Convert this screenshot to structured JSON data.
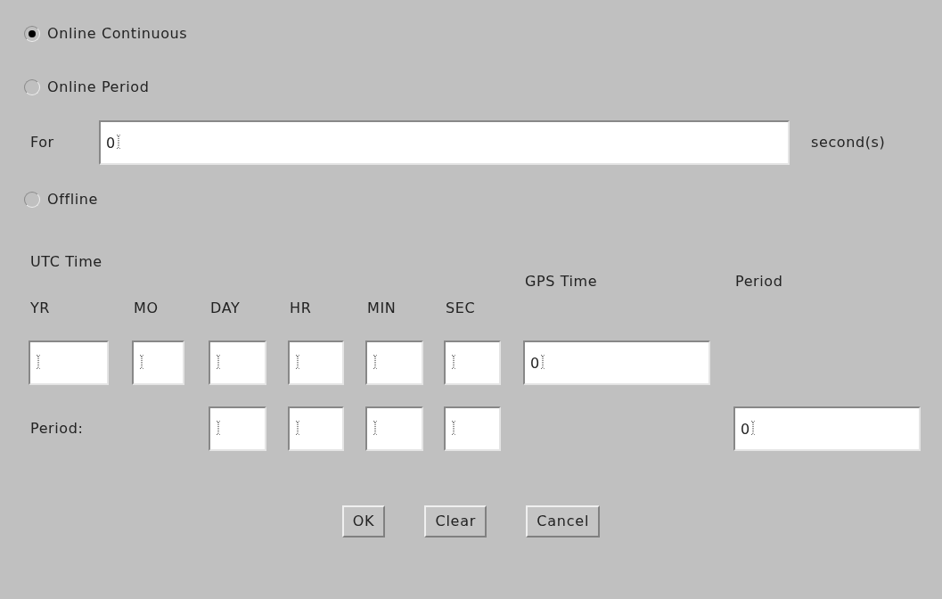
{
  "modes": [
    {
      "label": "Online Continuous",
      "selected": true
    },
    {
      "label": "Online Period",
      "selected": false
    },
    {
      "label": "Offline",
      "selected": false
    }
  ],
  "duration": {
    "label": "For",
    "value": "0",
    "unit": "second(s)"
  },
  "utc_label": "UTC Time",
  "columns": [
    {
      "label": "YR"
    },
    {
      "label": "MO"
    },
    {
      "label": "DAY"
    },
    {
      "label": "HR"
    },
    {
      "label": "MIN"
    },
    {
      "label": "SEC"
    },
    {
      "label": "GPS Time"
    },
    {
      "label": "Period"
    }
  ],
  "start_row": {
    "cells": [
      {
        "kind": "field"
      },
      {
        "kind": "field"
      },
      {
        "kind": "field"
      },
      {
        "kind": "field"
      },
      {
        "kind": "field"
      },
      {
        "kind": "field"
      },
      {
        "kind": "field",
        "value": "0"
      },
      {
        "kind": "blank"
      }
    ]
  },
  "period_row": {
    "label": "Period:",
    "cells": [
      {
        "kind": "blank"
      },
      {
        "kind": "blank"
      },
      {
        "kind": "field"
      },
      {
        "kind": "field"
      },
      {
        "kind": "field"
      },
      {
        "kind": "field"
      },
      {
        "kind": "blank"
      },
      {
        "kind": "field",
        "value": "0"
      }
    ]
  },
  "buttons": [
    {
      "label": "OK"
    },
    {
      "label": "Clear"
    },
    {
      "label": "Cancel"
    }
  ]
}
